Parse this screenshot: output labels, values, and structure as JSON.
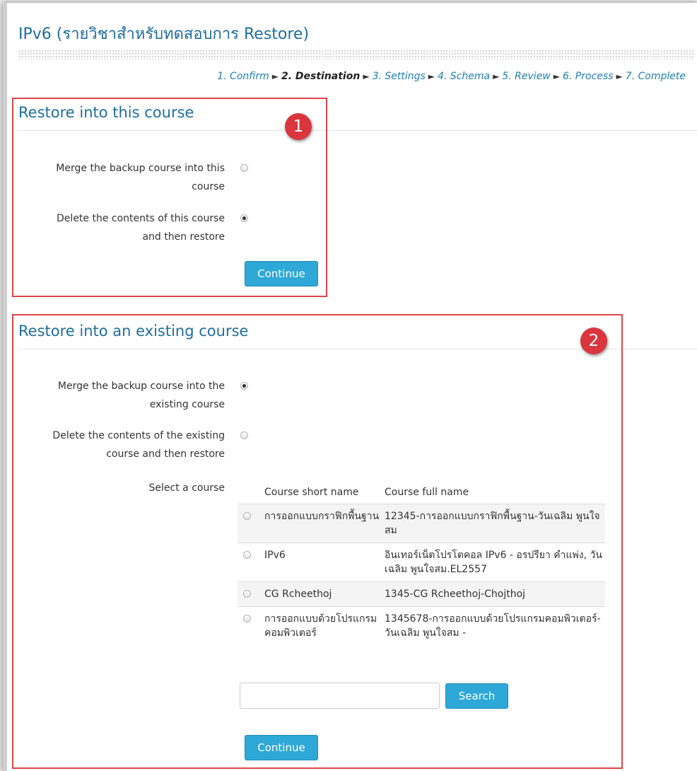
{
  "page": {
    "title": "IPv6 (รายวิชาสำหรับทดสอบการ Restore)"
  },
  "steps": [
    {
      "label": "1. Confirm",
      "current": false
    },
    {
      "label": "2. Destination",
      "current": true
    },
    {
      "label": "3. Settings",
      "current": false
    },
    {
      "label": "4. Schema",
      "current": false
    },
    {
      "label": "5. Review",
      "current": false
    },
    {
      "label": "6. Process",
      "current": false
    },
    {
      "label": "7. Complete",
      "current": false
    }
  ],
  "step_separator": "►",
  "section1": {
    "heading": "Restore into this course",
    "badge": "1",
    "options": [
      {
        "label_line1": "Merge the backup course into this",
        "label_line2": "course",
        "selected": false
      },
      {
        "label_line1": "Delete the contents of this course",
        "label_line2": "and then restore",
        "selected": true
      }
    ],
    "continue_label": "Continue"
  },
  "section2": {
    "heading": "Restore into an existing course",
    "badge": "2",
    "options": [
      {
        "label_line1": "Merge the backup course into the",
        "label_line2": "existing course",
        "selected": true
      },
      {
        "label_line1": "Delete the contents of the existing",
        "label_line2": "course and then restore",
        "selected": false
      }
    ],
    "select_label": "Select a course",
    "table": {
      "headers": {
        "short": "Course short name",
        "full": "Course full name"
      },
      "rows": [
        {
          "short": "การออกแบบกราฟิกพื้นฐาน",
          "full": "12345-การออกแบบกราฟิกพื้นฐาน-วันเฉลิม พูนใจสม"
        },
        {
          "short": "IPv6",
          "full": "อินเทอร์เน็ตโปรโตคอล IPv6 - อรปรียา คำแพ่ง, วันเฉลิม พูนใจสม.EL2557"
        },
        {
          "short": "CG Rcheethoj",
          "full": "1345-CG Rcheethoj-Chojthoj"
        },
        {
          "short": "การออกแบบด้วยโปรแกรมคอมพิวเตอร์",
          "full": "1345678-การออกแบบด้วยโปรแกรมคอมพิวเตอร์-วันเฉลิม พูนใจสม -"
        }
      ]
    },
    "search_value": "",
    "search_label": "Search",
    "continue_label": "Continue"
  }
}
